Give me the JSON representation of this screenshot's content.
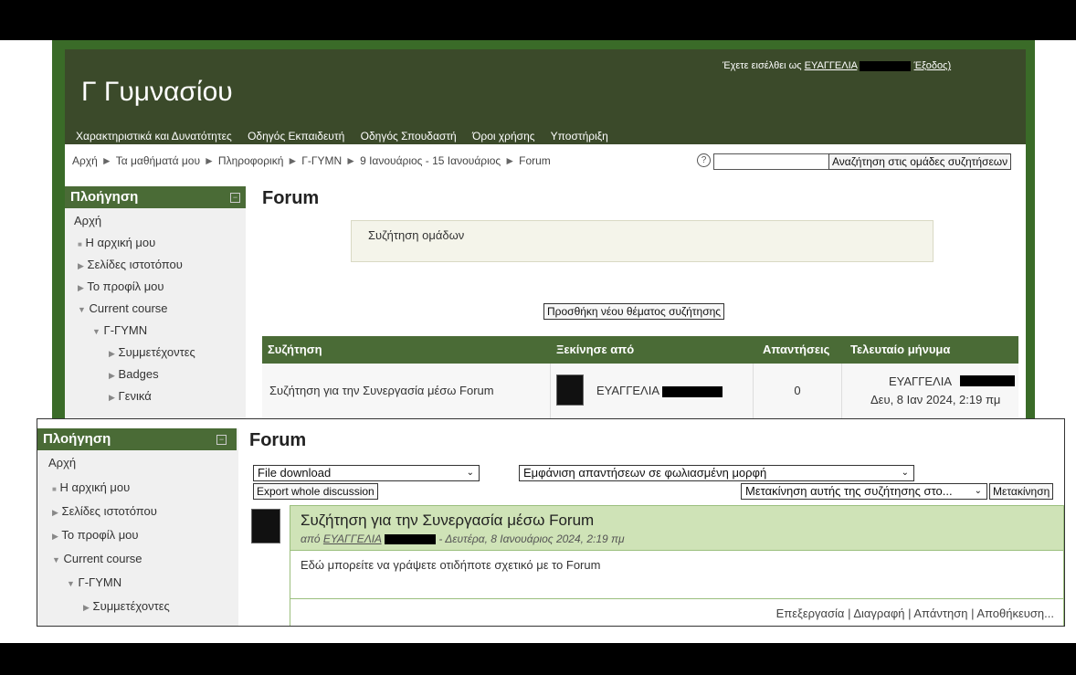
{
  "site": {
    "title": "Γ Γυμνασίου",
    "login_prefix": "Έχετε εισέλθει ως",
    "login_user": "ΕΥΑΓΓΕΛΙΑ",
    "logout_label": "Έξοδος)"
  },
  "menu": [
    "Χαρακτηριστικά και Δυνατότητες",
    "Οδηγός Εκπαιδευτή",
    "Οδηγός Σπουδαστή",
    "Όροι χρήσης",
    "Υποστήριξη"
  ],
  "breadcrumb": [
    "Αρχή",
    "Τα μαθήματά μου",
    "Πληροφορική",
    "Γ-ΓΥΜΝ",
    "9 Ιανουάριος - 15 Ιανουάριος",
    "Forum"
  ],
  "breadcrumb_sep": "►",
  "search": {
    "help_icon": "?",
    "button_label": "Αναζήτηση στις ομάδες συζητήσεων"
  },
  "nav_block": {
    "title": "Πλοήγηση",
    "items": [
      "Αρχή",
      "Η αρχική μου",
      "Σελίδες ιστοτόπου",
      "Το προφίλ μου",
      "Current course",
      "Γ-ΓΥΜΝ",
      "Συμμετέχοντες",
      "Badges",
      "Γενικά"
    ]
  },
  "forum": {
    "heading": "Forum",
    "intro": "Συζήτηση ομάδων",
    "add_button": "Προσθήκη νέου θέματος συζήτησης",
    "table": {
      "headers": [
        "Συζήτηση",
        "Ξεκίνησε από",
        "Απαντήσεις",
        "Τελευταίο μήνυμα"
      ],
      "row": {
        "discussion": "Συζήτηση για την Συνεργασία μέσω Forum",
        "started_by": "ΕΥΑΓΓΕΛΙΑ",
        "replies": "0",
        "last_author": "ΕΥΑΓΓΕΛΙΑ",
        "last_date": "Δευ, 8 Ιαν 2024, 2:19 πμ"
      }
    }
  },
  "discussion": {
    "heading": "Forum",
    "download_select": "File download",
    "display_select": "Εμφάνιση απαντήσεων σε φωλιασμένη μορφή",
    "export_button": "Export whole discussion",
    "move_select": "Μετακίνηση αυτής της συζήτησης στο...",
    "move_button": "Μετακίνηση",
    "post": {
      "title": "Συζήτηση για την Συνεργασία μέσω Forum",
      "by": "από",
      "author": "ΕΥΑΓΓΕΛΙΑ",
      "date": "- Δευτέρα, 8 Ιανουάριος 2024, 2:19 πμ",
      "body": "Εδώ μπορείτε να γράψετε οτιδήποτε σχετικό με το Forum",
      "commands": "Επεξεργασία | Διαγραφή | Απάντηση | Αποθήκευση..."
    }
  },
  "colors": {
    "frame": "#3a6b28",
    "header": "#3b4a2a",
    "block_header": "#4a6b36",
    "post_header": "#cfe3b7"
  }
}
